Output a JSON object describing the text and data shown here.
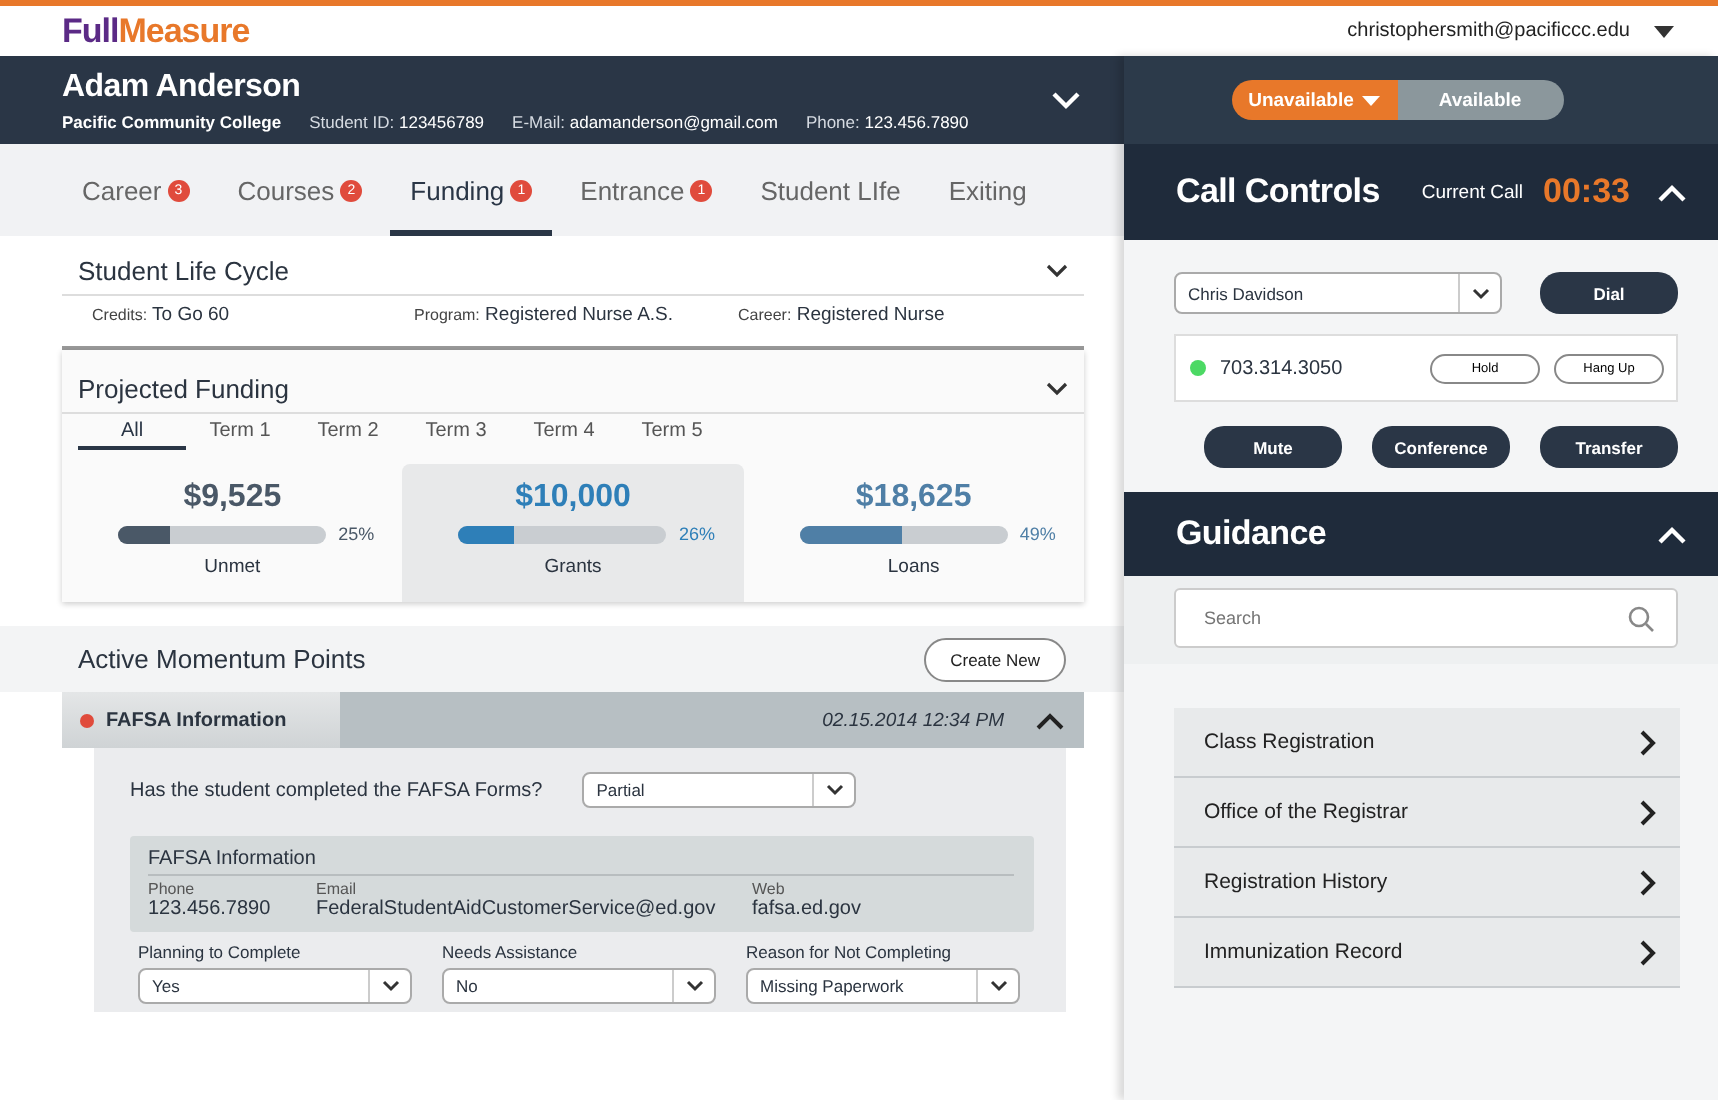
{
  "logo": {
    "primary": "Full",
    "accent": "Measure"
  },
  "user_menu": {
    "email": "christophersmith@pacificcc.edu"
  },
  "student": {
    "name": "Adam Anderson",
    "college": "Pacific Community College",
    "fields": [
      {
        "label": "Student ID:",
        "value": "123456789"
      },
      {
        "label": "E-Mail:",
        "value": "adamanderson@gmail.com"
      },
      {
        "label": "Phone:",
        "value": "123.456.7890"
      }
    ]
  },
  "tabs": [
    {
      "label": "Career",
      "count": "3",
      "selected": false
    },
    {
      "label": "Courses",
      "count": "2",
      "selected": false
    },
    {
      "label": "Funding",
      "count": "1",
      "selected": true
    },
    {
      "label": "Entrance",
      "count": "1",
      "selected": false
    },
    {
      "label": "Student LIfe",
      "selected": false
    },
    {
      "label": "Exiting",
      "selected": false
    }
  ],
  "life_cycle": {
    "title": "Student Life Cycle",
    "fields": [
      {
        "label": "Credits:",
        "value": "To Go 60"
      },
      {
        "label": "Program:",
        "value": "Registered Nurse A.S."
      },
      {
        "label": "Career:",
        "value": "Registered Nurse"
      }
    ]
  },
  "projected_funding": {
    "title": "Projected Funding",
    "terms": [
      {
        "label": "All",
        "selected": true
      },
      {
        "label": "Term 1",
        "selected": false
      },
      {
        "label": "Term 2",
        "selected": false
      },
      {
        "label": "Term 3",
        "selected": false
      },
      {
        "label": "Term 4",
        "selected": false
      },
      {
        "label": "Term 5",
        "selected": false
      }
    ],
    "cards": [
      {
        "amount": "$9,525",
        "level": 0.25,
        "percent": "25%",
        "label": "Unmet",
        "color": "#4a5867",
        "selected": false
      },
      {
        "amount": "$10,000",
        "level": 0.26,
        "percent": "26%",
        "label": "Grants",
        "color": "#2e7fb8",
        "selected": true
      },
      {
        "amount": "$18,625",
        "level": 0.49,
        "percent": "49%",
        "label": "Loans",
        "color": "#4f7fa6",
        "selected": false
      }
    ]
  },
  "momentum": {
    "title": "Active Momentum Points",
    "create_button": "Create New",
    "point": {
      "title": "FAFSA Information",
      "color": "#e04b3c",
      "datetime": "02.15.2014  12:34 PM",
      "expanded": true,
      "question": "Has the student completed the FAFSA Forms?",
      "answer": "Partial",
      "info": {
        "title": "FAFSA Information",
        "fields": [
          {
            "label": "Phone",
            "value": "123.456.7890"
          },
          {
            "label": "Email",
            "value": "FederalStudentAidCustomerService@ed.gov"
          },
          {
            "label": "Web",
            "value": "fafsa.ed.gov"
          }
        ]
      },
      "selects": [
        {
          "label": "Planning to Complete",
          "value": "Yes"
        },
        {
          "label": "Needs Assistance",
          "value": "No"
        },
        {
          "label": "Reason for Not Completing",
          "value": "Missing Paperwork"
        }
      ]
    }
  },
  "availability": [
    {
      "label": "Unavailable",
      "selected": true
    },
    {
      "label": "Available",
      "selected": false
    }
  ],
  "call_controls": {
    "title": "Call Controls",
    "current_label": "Current Call",
    "timer": "00:33",
    "expanded": true,
    "contact": "Chris Davidson",
    "dial": "Dial",
    "active_call": {
      "number": "703.314.3050",
      "color": "#4cd964",
      "buttons": [
        "Hold",
        "Hang Up"
      ]
    },
    "buttons": [
      "Mute",
      "Conference",
      "Transfer"
    ]
  },
  "guidance": {
    "title": "Guidance",
    "expanded": true,
    "search": {
      "placeholder": "Search"
    },
    "items": [
      "Class Registration",
      "Office of the Registrar",
      "Registration History",
      "Immunization Record"
    ]
  }
}
